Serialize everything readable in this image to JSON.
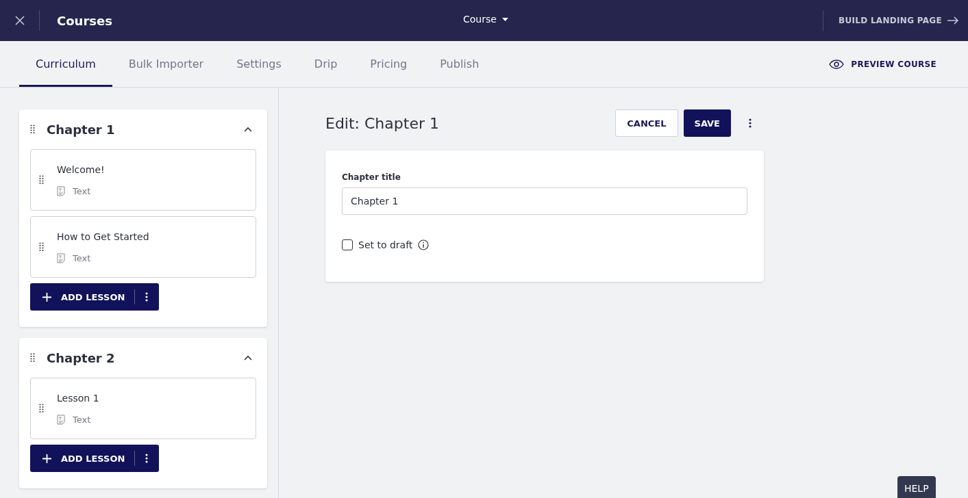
{
  "header": {
    "title": "Courses",
    "course_menu": "Course",
    "build_link": "BUILD LANDING PAGE"
  },
  "tabs": [
    {
      "label": "Curriculum",
      "selected": true
    },
    {
      "label": "Bulk Importer",
      "selected": false
    },
    {
      "label": "Settings",
      "selected": false
    },
    {
      "label": "Drip",
      "selected": false
    },
    {
      "label": "Pricing",
      "selected": false
    },
    {
      "label": "Publish",
      "selected": false
    }
  ],
  "preview_button": "PREVIEW COURSE",
  "chapters": [
    {
      "title": "Chapter 1",
      "expanded": true,
      "add_button": "ADD LESSON",
      "lessons": [
        {
          "title": "Welcome!",
          "type": "Text"
        },
        {
          "title": "How to Get Started",
          "type": "Text"
        }
      ]
    },
    {
      "title": "Chapter 2",
      "expanded": true,
      "add_button": "ADD LESSON",
      "lessons": [
        {
          "title": "Lesson 1",
          "type": "Text"
        }
      ]
    }
  ],
  "editor": {
    "heading": "Edit: Chapter 1",
    "cancel": "CANCEL",
    "save": "SAVE",
    "field_label": "Chapter title",
    "field_value": "Chapter 1",
    "draft_label": "Set to draft",
    "draft_checked": false
  },
  "help_button": "HELP"
}
